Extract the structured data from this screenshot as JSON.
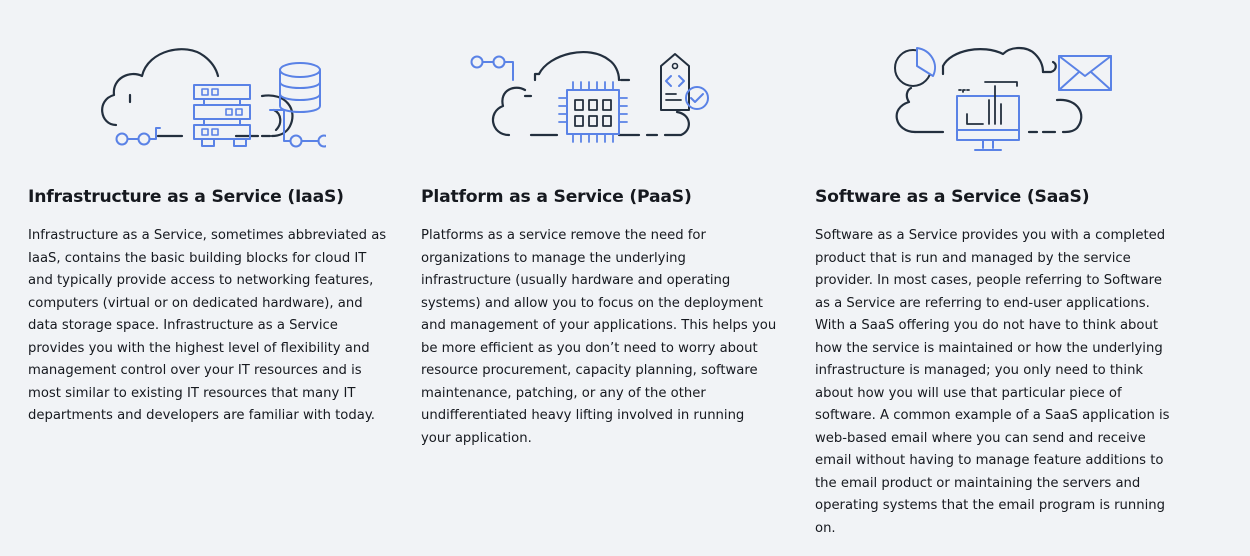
{
  "columns": [
    {
      "icon": "iaas-cloud-servers-database-icon",
      "title": "Infrastructure as a Service (IaaS)",
      "lines": [
        "Infrastructure as a Service, sometimes abbreviated as",
        "IaaS, contains the basic building blocks for cloud IT",
        "and typically provide access to networking features,",
        "computers (virtual or on dedicated hardware), and",
        "data storage space. Infrastructure as a Service",
        "provides you with the highest level of flexibility and",
        "management control over your IT resources and is",
        "most similar to existing IT resources that many IT",
        "departments and developers are familiar with today."
      ]
    },
    {
      "icon": "paas-cloud-chip-code-tag-icon",
      "title": "Platform as a Service (PaaS)",
      "lines": [
        "Platforms as a service remove the need for",
        "organizations to manage the underlying",
        "infrastructure (usually hardware and operating",
        "systems) and allow you to focus on the deployment",
        "and management of your applications. This helps you",
        "be more efficient as you don’t need to worry about",
        "resource procurement, capacity planning, software",
        "maintenance, patching, or any of the other",
        "undifferentiated heavy lifting involved in running",
        "your application."
      ]
    },
    {
      "icon": "saas-cloud-monitor-chart-mail-icon",
      "title": "Software as a Service (SaaS)",
      "lines": [
        "Software as a Service provides you with a completed",
        "product that is run and managed by the service",
        "provider. In most cases, people referring to Software",
        "as a Service are referring to end-user applications.",
        "With a SaaS offering you do not have to think about",
        "how the service is maintained or how the underlying",
        "infrastructure is managed; you only need to think",
        "about how you will use that particular piece of",
        "software. A common example of a SaaS application is",
        "web-based email where you can send and receive",
        "email without having to manage feature additions to",
        "the email product or maintaining the servers and",
        "operating systems that the email program is running",
        "on."
      ]
    }
  ],
  "colors": {
    "background": "#f1f3f6",
    "text": "#16191f",
    "illustration_dark": "#232f3e",
    "illustration_accent": "#5a82e6"
  }
}
